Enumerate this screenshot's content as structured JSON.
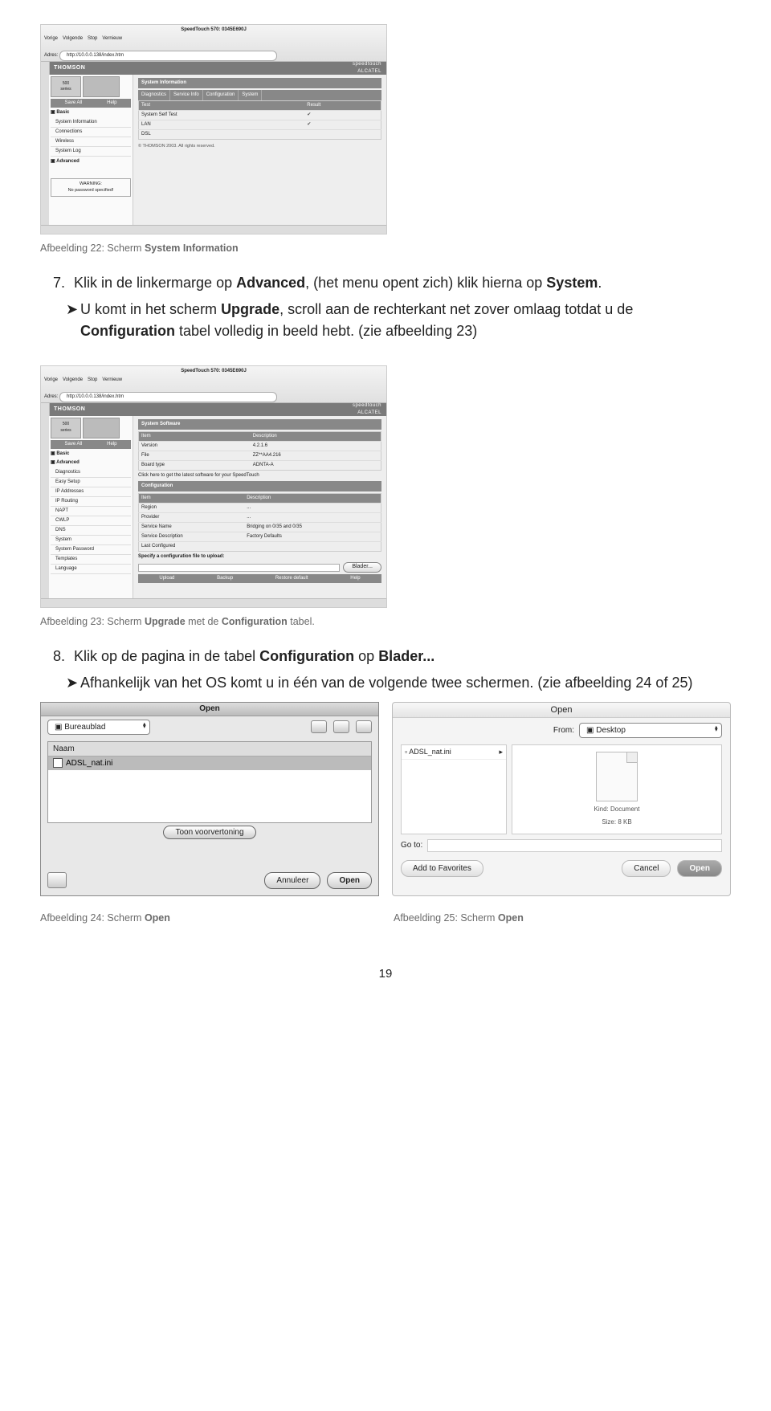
{
  "page_number": "19",
  "figure22": {
    "browser_title": "SpeedTouch 570: 0345E690J",
    "address": "http://10.0.0.138/index.htm",
    "brand_left": "THOMSON",
    "brand_right": "speedtouch\nALCATEL",
    "box500": "500\nseries",
    "sidebar_header": {
      "save": "Save All",
      "help": "Help"
    },
    "sidebar_groups": {
      "basic": "Basic",
      "advanced": "Advanced"
    },
    "sidebar_items": [
      "System Information",
      "Connections",
      "Wireless",
      "System Log"
    ],
    "warning": "WARNING:\nNo password specified!",
    "panel_title": "System Information",
    "tabs": [
      "Diagnostics",
      "Service Info",
      "Configuration",
      "System"
    ],
    "table_headers": [
      "Test",
      "Result"
    ],
    "rows": [
      {
        "test": "System Self Test",
        "result": "✔"
      },
      {
        "test": "LAN",
        "result": "✔"
      },
      {
        "test": "DSL",
        "result": ""
      }
    ],
    "footer": "© THOMSON 2003. All rights reserved."
  },
  "caption22": {
    "prefix": "Afbeelding 22: Scherm ",
    "bold": "System Information"
  },
  "step7": {
    "num": "7.",
    "text_pre": "Klik in de linkermarge op ",
    "b1": "Advanced",
    "text_mid": ", (het menu opent zich) klik hierna op ",
    "b2": "System",
    "text_end": "."
  },
  "arrow7": {
    "t1": "U komt in het scherm ",
    "b1": "Upgrade",
    "t2": ", scroll aan de rechterkant net zover omlaag totdat u de ",
    "b2": "Configuration",
    "t3": " tabel volledig in beeld hebt. (zie afbeelding 23)"
  },
  "figure23": {
    "browser_title": "SpeedTouch 570: 0345E690J",
    "address": "http://10.0.0.138/index.htm",
    "brand_left": "THOMSON",
    "brand_right": "speedtouch\nALCATEL",
    "box500": "500\nseries",
    "sidebar_header": {
      "save": "Save All",
      "help": "Help"
    },
    "sidebar_groups": {
      "basic": "Basic",
      "advanced": "Advanced"
    },
    "sidebar_items": [
      "Diagnostics",
      "Easy Setup",
      "IP Addresses",
      "IP Routing",
      "NAPT",
      "CWLP",
      "DNS",
      "System",
      "System Password",
      "Templates",
      "Language"
    ],
    "panel_title": "System Software",
    "sw_headers": [
      "Item",
      "Description"
    ],
    "sw_rows": [
      {
        "k": "Version",
        "v": "4.2.1.6"
      },
      {
        "k": "File",
        "v": "ZZ**AA4.216"
      },
      {
        "k": "Board type",
        "v": "ADNTA-A"
      }
    ],
    "link_line": "Click here to get the latest software for your SpeedTouch",
    "conf_title": "Configuration",
    "conf_headers": [
      "Item",
      "Description"
    ],
    "conf_rows": [
      {
        "k": "Region",
        "v": "..."
      },
      {
        "k": "Provider",
        "v": "..."
      },
      {
        "k": "Service Name",
        "v": "Bridging on 0/35 and 0/35"
      },
      {
        "k": "Service Description",
        "v": "Factory Defaults"
      },
      {
        "k": "Last Configured",
        "v": ""
      }
    ],
    "upload_label": "Specify a configuration file to upload:",
    "browse_btn": "Blader...",
    "action_bar": [
      "Upload",
      "Backup",
      "Restore default",
      "Help"
    ]
  },
  "caption23": {
    "prefix": "Afbeelding 23: Scherm ",
    "b1": "Upgrade",
    "mid": " met de ",
    "b2": "Configuration",
    "end": " tabel."
  },
  "step8": {
    "num": "8.",
    "t1": "Klik op de pagina in de tabel ",
    "b1": "Configuration",
    "t2": " op ",
    "b2": "Blader...",
    "t3": ""
  },
  "arrow8": {
    "t1": "Afhankelijk van het OS komt u in één van de volgende twee schermen. (zie afbeelding 24 of 25)"
  },
  "figure24": {
    "title": "Open",
    "location": "Bureaublad",
    "col_header": "Naam",
    "file": "ADSL_nat.ini",
    "preview_btn": "Toon voorvertoning",
    "cancel_btn": "Annuleer",
    "open_btn": "Open"
  },
  "figure25": {
    "title": "Open",
    "from_label": "From:",
    "from_value": "Desktop",
    "file": "ADSL_nat.ini",
    "kind": "Kind: Document",
    "size": "Size: 8 KB",
    "goto_label": "Go to:",
    "fav_btn": "Add to Favorites",
    "cancel_btn": "Cancel",
    "open_btn": "Open"
  },
  "caption24": {
    "prefix": "Afbeelding 24: Scherm ",
    "bold": "Open"
  },
  "caption25": {
    "prefix": "Afbeelding 25: Scherm ",
    "bold": "Open"
  }
}
